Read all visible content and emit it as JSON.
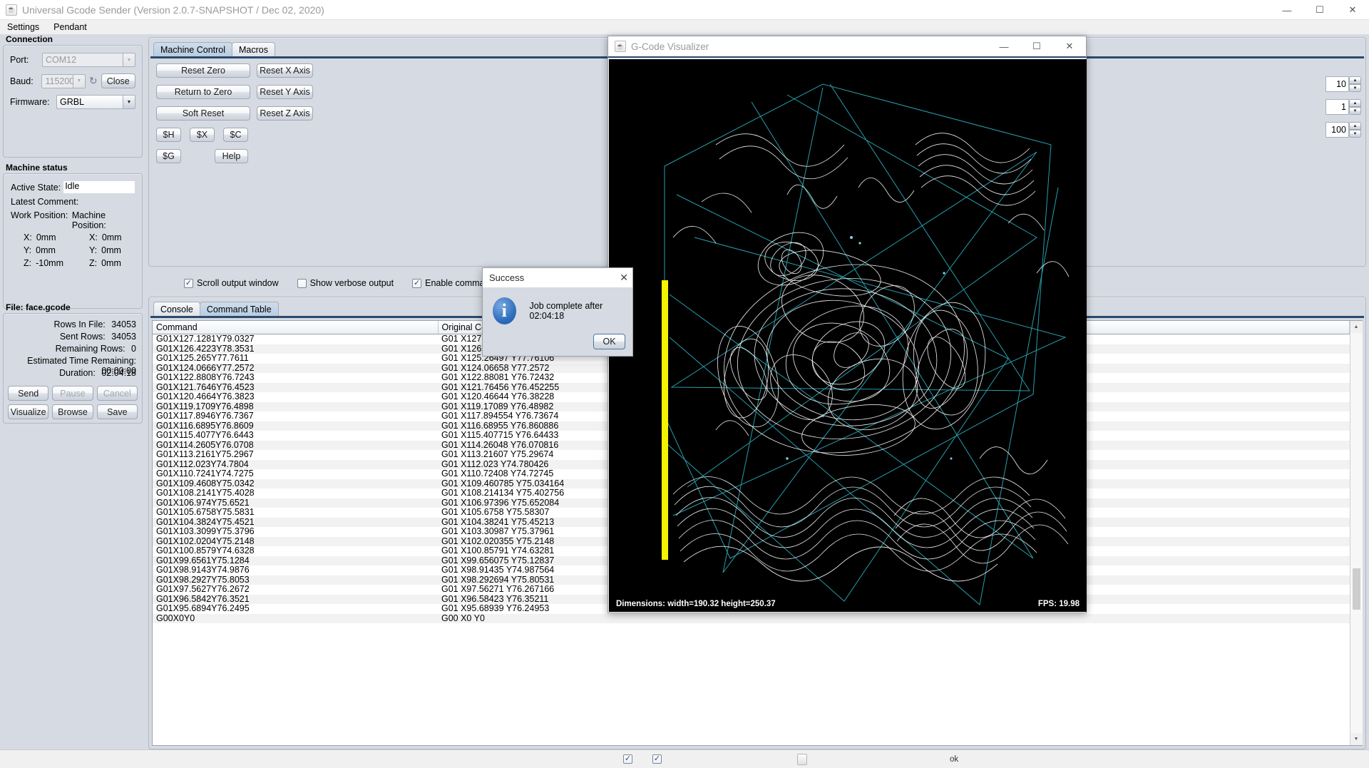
{
  "window": {
    "title": "Universal Gcode Sender (Version 2.0.7-SNAPSHOT / Dec 02, 2020)",
    "minimize": "—",
    "maximize": "☐",
    "close": "✕"
  },
  "menubar": {
    "items": [
      "Settings",
      "Pendant"
    ]
  },
  "connection": {
    "title": "Connection",
    "port_label": "Port:",
    "port_value": "COM12",
    "baud_label": "Baud:",
    "baud_value": "115200",
    "refresh_icon": "↻",
    "close_button": "Close",
    "firmware_label": "Firmware:",
    "firmware_value": "GRBL"
  },
  "machine_status": {
    "title": "Machine status",
    "active_state_label": "Active State:",
    "active_state_value": "Idle",
    "latest_comment_label": "Latest Comment:",
    "latest_comment_value": "",
    "work_position_label": "Work Position:",
    "machine_position_label": "Machine Position:",
    "work": [
      {
        "axis": "X:",
        "value": "0mm"
      },
      {
        "axis": "Y:",
        "value": "0mm"
      },
      {
        "axis": "Z:",
        "value": "-10mm"
      }
    ],
    "machine": [
      {
        "axis": "X:",
        "value": "0mm"
      },
      {
        "axis": "Y:",
        "value": "0mm"
      },
      {
        "axis": "Z:",
        "value": "0mm"
      }
    ]
  },
  "file_panel": {
    "title": "File: face.gcode",
    "stats": [
      {
        "label": "Rows In File:",
        "value": "34053"
      },
      {
        "label": "Sent Rows:",
        "value": "34053"
      },
      {
        "label": "Remaining Rows:",
        "value": "0"
      },
      {
        "label": "Estimated Time Remaining:",
        "value": "00:00:00"
      },
      {
        "label": "Duration:",
        "value": "02:04:18"
      }
    ],
    "buttons_row1": [
      {
        "label": "Send",
        "enabled": true
      },
      {
        "label": "Pause",
        "enabled": false
      },
      {
        "label": "Cancel",
        "enabled": false
      }
    ],
    "buttons_row2": [
      {
        "label": "Visualize",
        "enabled": true
      },
      {
        "label": "Browse",
        "enabled": true
      },
      {
        "label": "Save",
        "enabled": true
      }
    ]
  },
  "control_panel": {
    "tabs": [
      {
        "label": "Machine Control",
        "selected": true
      },
      {
        "label": "Macros",
        "selected": false
      }
    ],
    "buttons_left": [
      "Reset Zero",
      "Return to Zero",
      "Soft Reset"
    ],
    "buttons_right": [
      "Reset X Axis",
      "Reset Y Axis",
      "Reset Z Axis"
    ],
    "macro_buttons": [
      "$H",
      "$X",
      "$C"
    ],
    "macro_buttons2": [
      "$G"
    ],
    "help_button": "Help"
  },
  "output_options": {
    "checkboxes": [
      {
        "label": "Scroll output window",
        "checked": true
      },
      {
        "label": "Show verbose output",
        "checked": false
      },
      {
        "label": "Enable command table",
        "checked": true
      }
    ]
  },
  "console_panel": {
    "tabs": [
      {
        "label": "Console",
        "selected": false
      },
      {
        "label": "Command Table",
        "selected": true
      }
    ],
    "columns": [
      "Command",
      "Original Command"
    ],
    "rows": [
      [
        "G01X127.1281Y79.0327",
        "G01 X127.128075 Y79.03267"
      ],
      [
        "G01X126.4223Y78.3531",
        "G01 X126.42235 Y78.35307"
      ],
      [
        "G01X125.265Y77.7611",
        "G01 X125.26497 Y77.76106"
      ],
      [
        "G01X124.0666Y77.2572",
        "G01 X124.06658 Y77.2572"
      ],
      [
        "G01X122.8808Y76.7243",
        "G01 X122.88081 Y76.72432"
      ],
      [
        "G01X121.7646Y76.4523",
        "G01 X121.76456 Y76.452255"
      ],
      [
        "G01X120.4664Y76.3823",
        "G01 X120.46644 Y76.38228"
      ],
      [
        "G01X119.1709Y76.4898",
        "G01 X119.17089 Y76.48982"
      ],
      [
        "G01X117.8946Y76.7367",
        "G01 X117.894554 Y76.73674"
      ],
      [
        "G01X116.6895Y76.8609",
        "G01 X116.68955 Y76.860886"
      ],
      [
        "G01X115.4077Y76.6443",
        "G01 X115.407715 Y76.64433"
      ],
      [
        "G01X114.2605Y76.0708",
        "G01 X114.26048 Y76.070816"
      ],
      [
        "G01X113.2161Y75.2967",
        "G01 X113.21607 Y75.29674"
      ],
      [
        "G01X112.023Y74.7804",
        "G01 X112.023 Y74.780426"
      ],
      [
        "G01X110.7241Y74.7275",
        "G01 X110.72408 Y74.72745"
      ],
      [
        "G01X109.4608Y75.0342",
        "G01 X109.460785 Y75.034164"
      ],
      [
        "G01X108.2141Y75.4028",
        "G01 X108.214134 Y75.402756"
      ],
      [
        "G01X106.974Y75.6521",
        "G01 X106.97396 Y75.652084"
      ],
      [
        "G01X105.6758Y75.5831",
        "G01 X105.6758 Y75.58307"
      ],
      [
        "G01X104.3824Y75.4521",
        "G01 X104.38241 Y75.45213"
      ],
      [
        "G01X103.3099Y75.3796",
        "G01 X103.30987 Y75.37961"
      ],
      [
        "G01X102.0204Y75.2148",
        "G01 X102.020355 Y75.2148"
      ],
      [
        "G01X100.8579Y74.6328",
        "G01 X100.85791 Y74.63281"
      ],
      [
        "G01X99.6561Y75.1284",
        "G01 X99.656075 Y75.12837"
      ],
      [
        "G01X98.9143Y74.9876",
        "G01 X98.91435 Y74.987564"
      ],
      [
        "G01X98.2927Y75.8053",
        "G01 X98.292694 Y75.80531"
      ],
      [
        "G01X97.5627Y76.2672",
        "G01 X97.56271 Y76.267166"
      ],
      [
        "G01X96.5842Y76.3521",
        "G01 X96.58423 Y76.35211"
      ],
      [
        "G01X95.6894Y76.2495",
        "G01 X95.68939 Y76.24953"
      ],
      [
        "G00X0Y0",
        "G00 X0 Y0"
      ]
    ]
  },
  "right_spinners": [
    {
      "value": "10"
    },
    {
      "value": "1"
    },
    {
      "value": "100"
    }
  ],
  "visualizer": {
    "title": "G-Code Visualizer",
    "minimize": "—",
    "maximize": "☐",
    "close": "✕",
    "dimensions": "Dimensions: width=190.32 height=250.37",
    "fps": "FPS: 19.98",
    "colors": {
      "background": "#000000",
      "toolpath": "#ffffff",
      "rapid": "#2aa7b5",
      "axis_marker": "#f5f300"
    }
  },
  "bottom_bar": {
    "checkbox1_checked": true,
    "checkbox2_checked": true,
    "status_text": "ok"
  },
  "success_dialog": {
    "title": "Success",
    "close": "✕",
    "icon": "i",
    "message": "Job complete after 02:04:18",
    "ok_button": "OK"
  }
}
